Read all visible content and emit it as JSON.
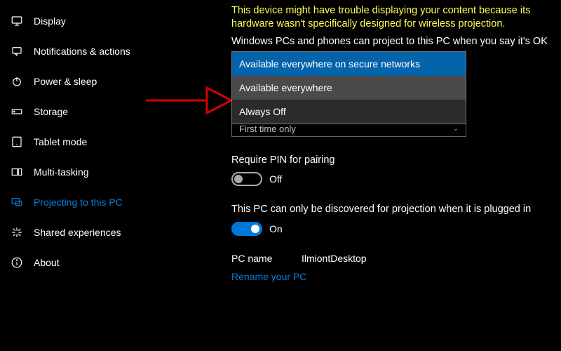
{
  "sidebar": {
    "items": [
      {
        "label": "Display"
      },
      {
        "label": "Notifications & actions"
      },
      {
        "label": "Power & sleep"
      },
      {
        "label": "Storage"
      },
      {
        "label": "Tablet mode"
      },
      {
        "label": "Multi-tasking"
      },
      {
        "label": "Projecting to this PC"
      },
      {
        "label": "Shared experiences"
      },
      {
        "label": "About"
      }
    ]
  },
  "main": {
    "warning": "This device might have trouble displaying your content because its hardware wasn't specifically designed for wireless projection.",
    "project_label": "Windows PCs and phones can project to this PC when you say it's OK",
    "dropdown": {
      "options": [
        "Available everywhere on secure networks",
        "Available everywhere",
        "Always Off"
      ],
      "hidden_value": "First time only"
    },
    "pin_label": "Require PIN for pairing",
    "pin_state": "Off",
    "discover_label": "This PC can only be discovered for projection when it is plugged in",
    "discover_state": "On",
    "pc_name_key": "PC name",
    "pc_name_value": "IlmiontDesktop",
    "rename_link": "Rename your PC"
  }
}
